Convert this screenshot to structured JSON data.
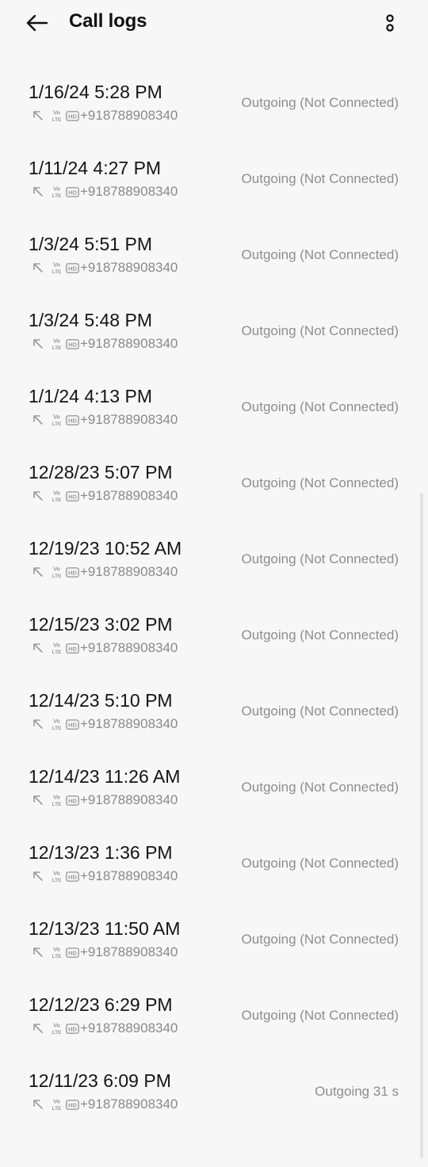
{
  "header": {
    "title": "Call logs",
    "back_icon": "arrow-left-icon",
    "menu_icon": "more-vertical-icon"
  },
  "calls": [
    {
      "datetime": "1/16/24 5:28 PM",
      "number": "+918788908340",
      "status": "Outgoing (Not Connected)"
    },
    {
      "datetime": "1/11/24 4:27 PM",
      "number": "+918788908340",
      "status": "Outgoing (Not Connected)"
    },
    {
      "datetime": "1/3/24 5:51 PM",
      "number": "+918788908340",
      "status": "Outgoing (Not Connected)"
    },
    {
      "datetime": "1/3/24 5:48 PM",
      "number": "+918788908340",
      "status": "Outgoing (Not Connected)"
    },
    {
      "datetime": "1/1/24 4:13 PM",
      "number": "+918788908340",
      "status": "Outgoing (Not Connected)"
    },
    {
      "datetime": "12/28/23 5:07 PM",
      "number": "+918788908340",
      "status": "Outgoing (Not Connected)"
    },
    {
      "datetime": "12/19/23 10:52 AM",
      "number": "+918788908340",
      "status": "Outgoing (Not Connected)"
    },
    {
      "datetime": "12/15/23 3:02 PM",
      "number": "+918788908340",
      "status": "Outgoing (Not Connected)"
    },
    {
      "datetime": "12/14/23 5:10 PM",
      "number": "+918788908340",
      "status": "Outgoing (Not Connected)"
    },
    {
      "datetime": "12/14/23 11:26 AM",
      "number": "+918788908340",
      "status": "Outgoing (Not Connected)"
    },
    {
      "datetime": "12/13/23 1:36 PM",
      "number": "+918788908340",
      "status": "Outgoing (Not Connected)"
    },
    {
      "datetime": "12/13/23 11:50 AM",
      "number": "+918788908340",
      "status": "Outgoing (Not Connected)"
    },
    {
      "datetime": "12/12/23 6:29 PM",
      "number": "+918788908340",
      "status": "Outgoing (Not Connected)"
    },
    {
      "datetime": "12/11/23 6:09 PM",
      "number": "+918788908340",
      "status": "Outgoing  31 s"
    }
  ],
  "icons": {
    "direction": "outgoing-call-icon",
    "network": "volte-icon",
    "quality": "hd-icon"
  },
  "colors": {
    "background": "#f7f7f7",
    "primary_text": "#141414",
    "secondary_text": "#8a8a8a"
  }
}
